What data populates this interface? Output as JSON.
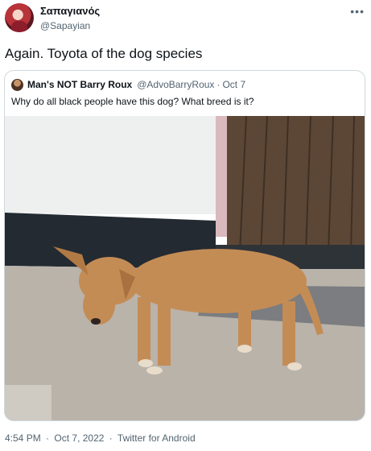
{
  "author": {
    "display_name": "Σαπαγιανός",
    "handle": "@Sapayian",
    "more_icon": "more-horizontal-icon"
  },
  "tweet": {
    "text": "Again. Toyota of the dog species"
  },
  "quoted": {
    "display_name": "Man's NOT Barry Roux",
    "badge_icon": "apple-icon",
    "handle": "@AdvoBarryRoux",
    "separator": "·",
    "date": "Oct 7",
    "text": "Why do all black people have this dog? What breed is it?"
  },
  "meta": {
    "time": "4:54 PM",
    "separator": "·",
    "date": "Oct 7, 2022",
    "source": "Twitter for Android"
  },
  "colors": {
    "text": "#0f1419",
    "secondary": "#536471",
    "border": "#cfd9de",
    "wall": "#eef0f0",
    "wall_base": "#232a31",
    "door": "#5c4736",
    "ground": "#b9b3aa",
    "dog": "#c48c55"
  }
}
